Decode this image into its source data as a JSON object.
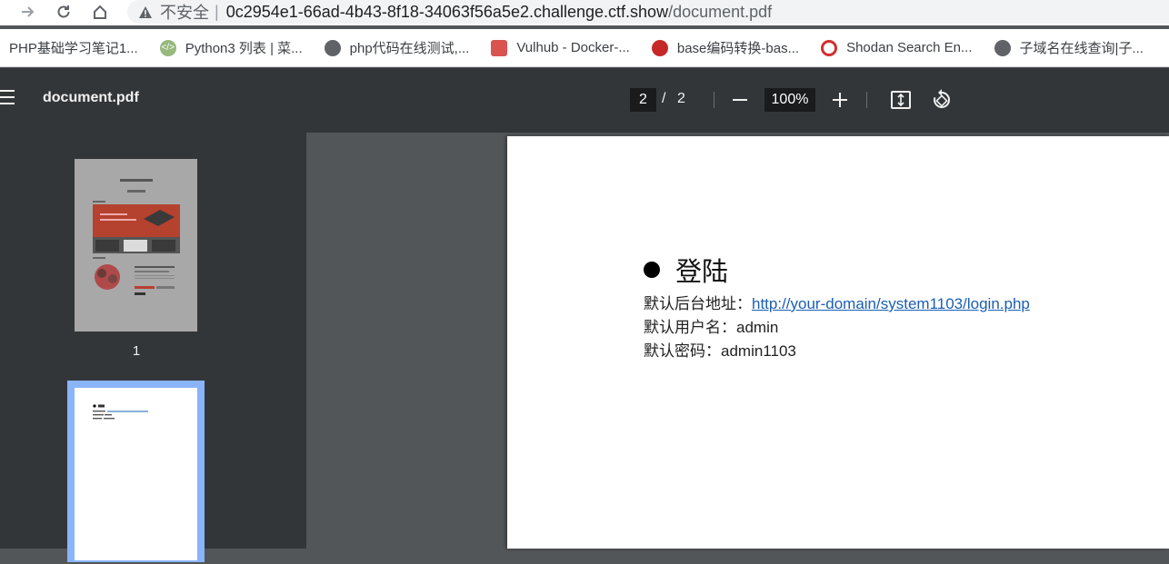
{
  "browser": {
    "insecure_label": "不安全",
    "separator": "|",
    "url_host": "0c2954e1-66ad-4b43-8f18-34063f56a5e2.challenge.ctf.show",
    "url_path": "/document.pdf"
  },
  "bookmarks": [
    {
      "label": "PHP基础学习笔记1...",
      "icon": "none"
    },
    {
      "label": "Python3 列表 | 菜...",
      "icon": "runoob-icon",
      "color": "#96b97d"
    },
    {
      "label": "php代码在线测试,...",
      "icon": "globe-icon",
      "color": "#5f6368"
    },
    {
      "label": "Vulhub - Docker-...",
      "icon": "vulhub-icon",
      "color": "#d9534f"
    },
    {
      "label": "base编码转换-bas...",
      "icon": "base-icon",
      "color": "#c62828"
    },
    {
      "label": "Shodan Search En...",
      "icon": "shodan-icon",
      "color": "#d32f2f"
    },
    {
      "label": "子域名在线查询|子...",
      "icon": "globe-icon",
      "color": "#5f6368"
    }
  ],
  "toolbar": {
    "title": "document.pdf",
    "current_page": "2",
    "page_separator": "/",
    "total_pages": "2",
    "zoom": "100%"
  },
  "sidebar": {
    "thumbnail_1_label": "1"
  },
  "page_content": {
    "heading": "登陆",
    "admin_url_label": "默认后台地址：",
    "admin_url": "http://your-domain/system1103/login.php",
    "username_label": "默认用户名：",
    "username": "admin",
    "password_label": "默认密码：",
    "password": "admin1103"
  },
  "colors": {
    "toolbar_bg": "#323639",
    "viewer_bg": "#525659",
    "link": "#1a5fb4",
    "thumbnail_selected": "#8ab4f8"
  }
}
